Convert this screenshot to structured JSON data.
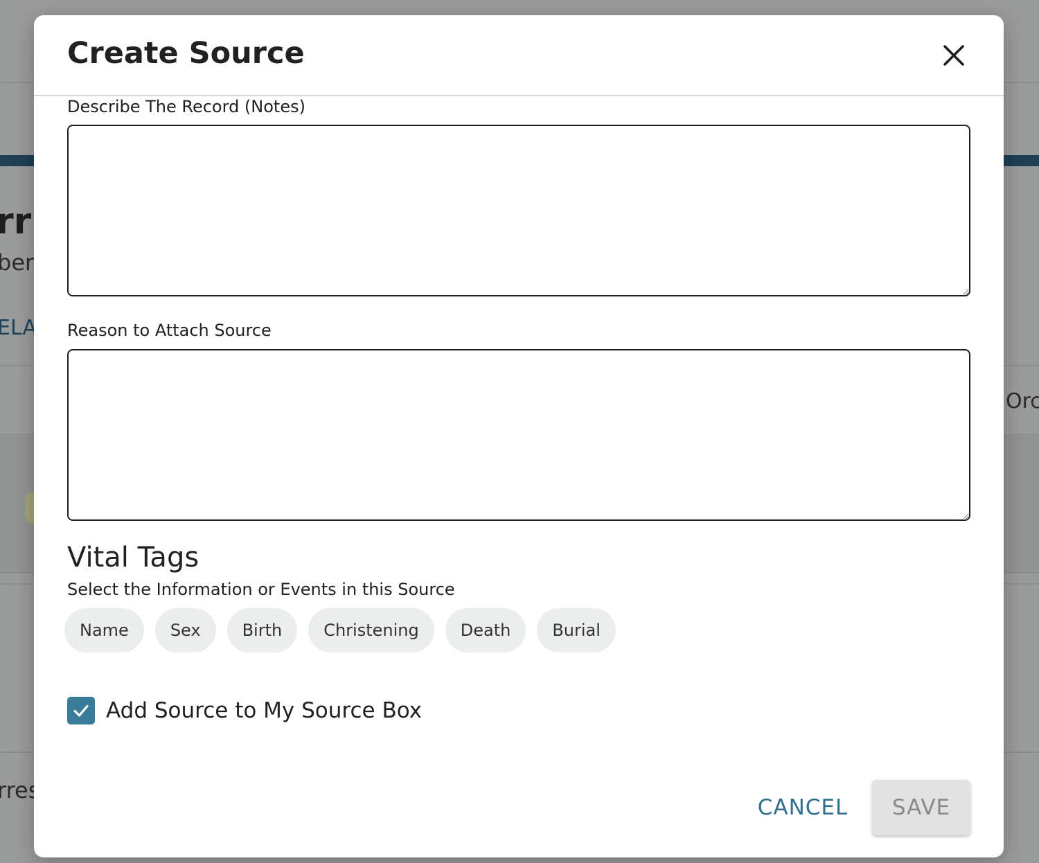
{
  "background": {
    "heading_fragment": "rr",
    "subheading_fragment": "ber",
    "tab_fragment": "ELAT",
    "right_fragment": "Orc",
    "bottom_fragment": "rres"
  },
  "modal": {
    "title": "Create Source",
    "close_icon": "close-icon",
    "notes": {
      "label": "Describe The Record (Notes)",
      "value": ""
    },
    "reason": {
      "label": "Reason to Attach Source",
      "value": ""
    },
    "vital_tags": {
      "title": "Vital Tags",
      "subtitle": "Select the Information or Events in this Source",
      "tags": [
        "Name",
        "Sex",
        "Birth",
        "Christening",
        "Death",
        "Burial"
      ]
    },
    "source_box": {
      "label": "Add Source to My Source Box",
      "checked": true
    },
    "actions": {
      "cancel_label": "CANCEL",
      "save_label": "SAVE"
    }
  },
  "colors": {
    "accent": "#3a7d9b",
    "link": "#2f6f8f",
    "overlay": "#9a9b9b"
  }
}
